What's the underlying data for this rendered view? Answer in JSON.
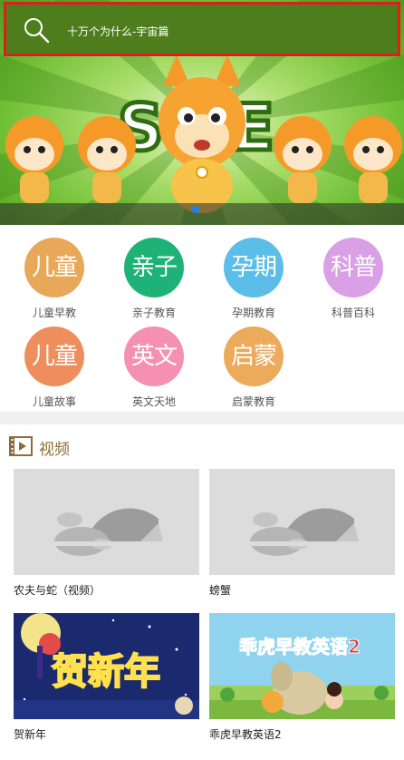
{
  "search": {
    "placeholder_text": "十万个为什么-宇宙篇"
  },
  "categories": [
    {
      "circle_text": "儿童",
      "label": "儿童早教",
      "color": "#e8a85a"
    },
    {
      "circle_text": "亲子",
      "label": "亲子教育",
      "color": "#1fb276"
    },
    {
      "circle_text": "孕期",
      "label": "孕期教育",
      "color": "#5bbde8"
    },
    {
      "circle_text": "科普",
      "label": "科普百科",
      "color": "#d9a0e6"
    },
    {
      "circle_text": "儿童",
      "label": "儿童故事",
      "color": "#ee8e5c"
    },
    {
      "circle_text": "英文",
      "label": "英文天地",
      "color": "#f590b3"
    },
    {
      "circle_text": "启蒙",
      "label": "启蒙教育",
      "color": "#ecaa5b"
    }
  ],
  "video_section": {
    "title": "视频",
    "videos": [
      {
        "title": "农夫与蛇（视频）"
      },
      {
        "title": "螃蟹"
      },
      {
        "title": "贺新年",
        "thumb_text": "贺新年"
      },
      {
        "title": "乖虎早教英语2",
        "thumb_text": "乖虎早教英语2"
      }
    ]
  }
}
